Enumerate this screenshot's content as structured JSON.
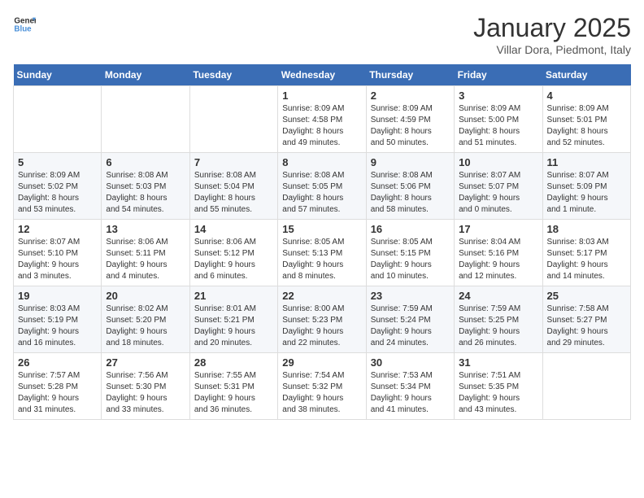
{
  "header": {
    "logo_line1": "General",
    "logo_line2": "Blue",
    "month": "January 2025",
    "location": "Villar Dora, Piedmont, Italy"
  },
  "weekdays": [
    "Sunday",
    "Monday",
    "Tuesday",
    "Wednesday",
    "Thursday",
    "Friday",
    "Saturday"
  ],
  "weeks": [
    [
      {
        "day": "",
        "info": ""
      },
      {
        "day": "",
        "info": ""
      },
      {
        "day": "",
        "info": ""
      },
      {
        "day": "1",
        "info": "Sunrise: 8:09 AM\nSunset: 4:58 PM\nDaylight: 8 hours\nand 49 minutes."
      },
      {
        "day": "2",
        "info": "Sunrise: 8:09 AM\nSunset: 4:59 PM\nDaylight: 8 hours\nand 50 minutes."
      },
      {
        "day": "3",
        "info": "Sunrise: 8:09 AM\nSunset: 5:00 PM\nDaylight: 8 hours\nand 51 minutes."
      },
      {
        "day": "4",
        "info": "Sunrise: 8:09 AM\nSunset: 5:01 PM\nDaylight: 8 hours\nand 52 minutes."
      }
    ],
    [
      {
        "day": "5",
        "info": "Sunrise: 8:09 AM\nSunset: 5:02 PM\nDaylight: 8 hours\nand 53 minutes."
      },
      {
        "day": "6",
        "info": "Sunrise: 8:08 AM\nSunset: 5:03 PM\nDaylight: 8 hours\nand 54 minutes."
      },
      {
        "day": "7",
        "info": "Sunrise: 8:08 AM\nSunset: 5:04 PM\nDaylight: 8 hours\nand 55 minutes."
      },
      {
        "day": "8",
        "info": "Sunrise: 8:08 AM\nSunset: 5:05 PM\nDaylight: 8 hours\nand 57 minutes."
      },
      {
        "day": "9",
        "info": "Sunrise: 8:08 AM\nSunset: 5:06 PM\nDaylight: 8 hours\nand 58 minutes."
      },
      {
        "day": "10",
        "info": "Sunrise: 8:07 AM\nSunset: 5:07 PM\nDaylight: 9 hours\nand 0 minutes."
      },
      {
        "day": "11",
        "info": "Sunrise: 8:07 AM\nSunset: 5:09 PM\nDaylight: 9 hours\nand 1 minute."
      }
    ],
    [
      {
        "day": "12",
        "info": "Sunrise: 8:07 AM\nSunset: 5:10 PM\nDaylight: 9 hours\nand 3 minutes."
      },
      {
        "day": "13",
        "info": "Sunrise: 8:06 AM\nSunset: 5:11 PM\nDaylight: 9 hours\nand 4 minutes."
      },
      {
        "day": "14",
        "info": "Sunrise: 8:06 AM\nSunset: 5:12 PM\nDaylight: 9 hours\nand 6 minutes."
      },
      {
        "day": "15",
        "info": "Sunrise: 8:05 AM\nSunset: 5:13 PM\nDaylight: 9 hours\nand 8 minutes."
      },
      {
        "day": "16",
        "info": "Sunrise: 8:05 AM\nSunset: 5:15 PM\nDaylight: 9 hours\nand 10 minutes."
      },
      {
        "day": "17",
        "info": "Sunrise: 8:04 AM\nSunset: 5:16 PM\nDaylight: 9 hours\nand 12 minutes."
      },
      {
        "day": "18",
        "info": "Sunrise: 8:03 AM\nSunset: 5:17 PM\nDaylight: 9 hours\nand 14 minutes."
      }
    ],
    [
      {
        "day": "19",
        "info": "Sunrise: 8:03 AM\nSunset: 5:19 PM\nDaylight: 9 hours\nand 16 minutes."
      },
      {
        "day": "20",
        "info": "Sunrise: 8:02 AM\nSunset: 5:20 PM\nDaylight: 9 hours\nand 18 minutes."
      },
      {
        "day": "21",
        "info": "Sunrise: 8:01 AM\nSunset: 5:21 PM\nDaylight: 9 hours\nand 20 minutes."
      },
      {
        "day": "22",
        "info": "Sunrise: 8:00 AM\nSunset: 5:23 PM\nDaylight: 9 hours\nand 22 minutes."
      },
      {
        "day": "23",
        "info": "Sunrise: 7:59 AM\nSunset: 5:24 PM\nDaylight: 9 hours\nand 24 minutes."
      },
      {
        "day": "24",
        "info": "Sunrise: 7:59 AM\nSunset: 5:25 PM\nDaylight: 9 hours\nand 26 minutes."
      },
      {
        "day": "25",
        "info": "Sunrise: 7:58 AM\nSunset: 5:27 PM\nDaylight: 9 hours\nand 29 minutes."
      }
    ],
    [
      {
        "day": "26",
        "info": "Sunrise: 7:57 AM\nSunset: 5:28 PM\nDaylight: 9 hours\nand 31 minutes."
      },
      {
        "day": "27",
        "info": "Sunrise: 7:56 AM\nSunset: 5:30 PM\nDaylight: 9 hours\nand 33 minutes."
      },
      {
        "day": "28",
        "info": "Sunrise: 7:55 AM\nSunset: 5:31 PM\nDaylight: 9 hours\nand 36 minutes."
      },
      {
        "day": "29",
        "info": "Sunrise: 7:54 AM\nSunset: 5:32 PM\nDaylight: 9 hours\nand 38 minutes."
      },
      {
        "day": "30",
        "info": "Sunrise: 7:53 AM\nSunset: 5:34 PM\nDaylight: 9 hours\nand 41 minutes."
      },
      {
        "day": "31",
        "info": "Sunrise: 7:51 AM\nSunset: 5:35 PM\nDaylight: 9 hours\nand 43 minutes."
      },
      {
        "day": "",
        "info": ""
      }
    ]
  ]
}
